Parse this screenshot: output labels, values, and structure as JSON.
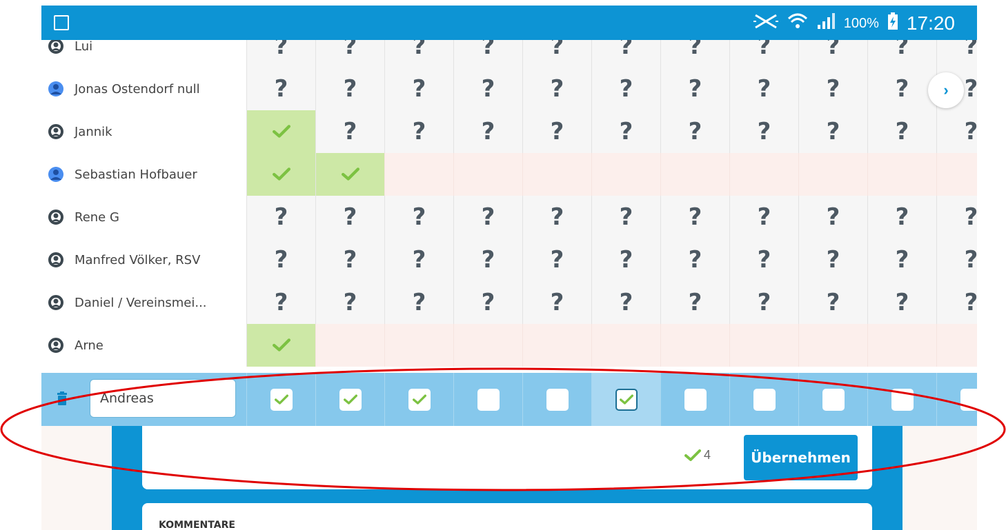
{
  "status_bar": {
    "battery": "100%",
    "time": "17:20",
    "icons": [
      "gallery-icon",
      "mute-icon",
      "wifi-icon",
      "signal-icon",
      "battery-charging-icon"
    ]
  },
  "participants": [
    {
      "name": "Lui",
      "avatar": "generic-user-icon",
      "cells": [
        "?",
        "?",
        "?",
        "?",
        "?",
        "?",
        "?",
        "?",
        "?",
        "?",
        "?"
      ]
    },
    {
      "name": "Jonas Ostendorf null",
      "avatar": "profile-avatar-icon",
      "cells": [
        "?",
        "?",
        "?",
        "?",
        "?",
        "?",
        "?",
        "?",
        "?",
        "?",
        "?"
      ]
    },
    {
      "name": "Jannik",
      "avatar": "generic-user-icon",
      "cells": [
        "yes",
        "?",
        "?",
        "?",
        "?",
        "?",
        "?",
        "?",
        "?",
        "?",
        "?"
      ]
    },
    {
      "name": "Sebastian Hofbauer",
      "avatar": "profile-avatar-icon",
      "cells": [
        "yes",
        "yes",
        "no",
        "no",
        "no",
        "no",
        "no",
        "no",
        "no",
        "no",
        "no"
      ]
    },
    {
      "name": "Rene G",
      "avatar": "generic-user-icon",
      "cells": [
        "?",
        "?",
        "?",
        "?",
        "?",
        "?",
        "?",
        "?",
        "?",
        "?",
        "?"
      ]
    },
    {
      "name": "Manfred Völker, RSV",
      "avatar": "generic-user-icon",
      "cells": [
        "?",
        "?",
        "?",
        "?",
        "?",
        "?",
        "?",
        "?",
        "?",
        "?",
        "?"
      ]
    },
    {
      "name": "Daniel / Vereinsmei...",
      "avatar": "generic-user-icon",
      "cells": [
        "?",
        "?",
        "?",
        "?",
        "?",
        "?",
        "?",
        "?",
        "?",
        "?",
        "?"
      ]
    },
    {
      "name": "Arne",
      "avatar": "generic-user-icon",
      "cells": [
        "yes",
        "no",
        "no",
        "no",
        "no",
        "no",
        "no",
        "no",
        "no",
        "no",
        "no"
      ]
    }
  ],
  "edit_row": {
    "name_value": "Andreas",
    "checks": [
      true,
      true,
      true,
      false,
      false,
      true,
      false,
      false,
      false,
      false,
      false
    ],
    "focused_index": 5
  },
  "summary": {
    "count": "4",
    "apply_label": "Übernehmen"
  },
  "comments": {
    "title": "KOMMENTARE"
  },
  "colors": {
    "primary": "#0d94d4",
    "yes_bg": "#cde8a6",
    "no_bg": "#fcefec",
    "check": "#7cc242",
    "edit_row_bg": "#86c8ec",
    "annotation": "#e00000"
  }
}
